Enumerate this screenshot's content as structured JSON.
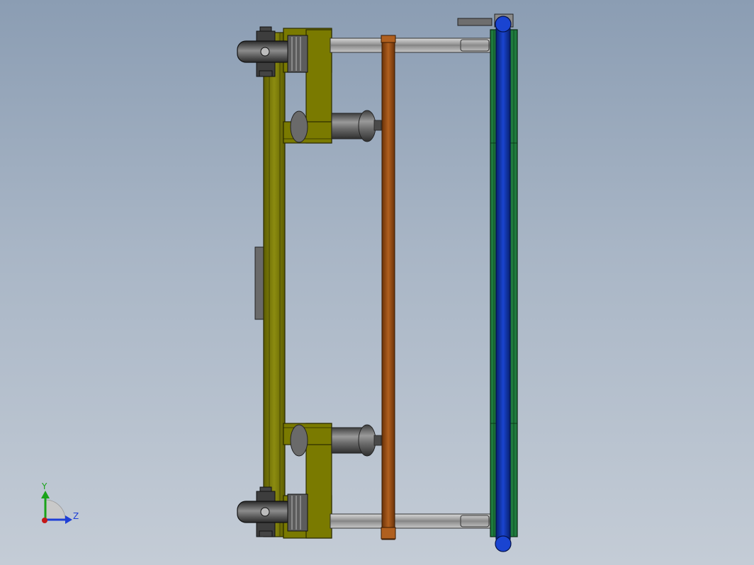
{
  "viewport": {
    "background_top": "#8b9db3",
    "background_bottom": "#c4ccd6"
  },
  "model": {
    "frame_color": "#7a7a00",
    "rod_color": "#8b4513",
    "belt_color": "#0b2ca8",
    "rail_color": "#1e7a3c",
    "steel_color": "#5a5a5a",
    "wheel_color": "#3c3c3c"
  },
  "triad": {
    "y_label": "Y",
    "z_label": "Z",
    "y_color": "#1aa31a",
    "z_color": "#1f3fd6",
    "x_color": "#c41818"
  }
}
